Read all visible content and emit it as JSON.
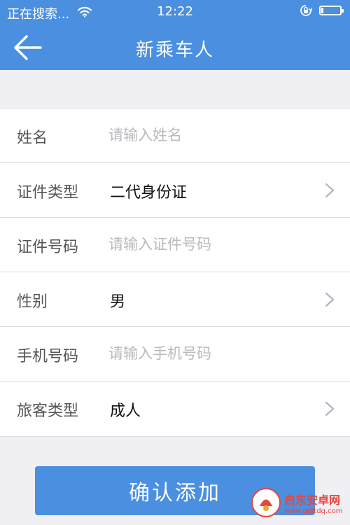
{
  "status_bar": {
    "carrier": "正在搜索...",
    "time": "12:22",
    "battery_level": 0.12
  },
  "nav": {
    "title": "新乘车人"
  },
  "form": {
    "name": {
      "label": "姓名",
      "placeholder": "请输入姓名"
    },
    "id_type": {
      "label": "证件类型",
      "value": "二代身份证"
    },
    "id_number": {
      "label": "证件号码",
      "placeholder": "请输入证件号码"
    },
    "gender": {
      "label": "性别",
      "value": "男"
    },
    "phone": {
      "label": "手机号码",
      "placeholder": "请输入手机号码"
    },
    "passenger_type": {
      "label": "旅客类型",
      "value": "成人"
    }
  },
  "confirm_button": {
    "label": "确认添加"
  },
  "watermark": {
    "name": "启东安卓网",
    "url": "www.qdltdq.com"
  },
  "colors": {
    "accent": "#4a8fe0",
    "background": "#efeff4",
    "placeholder": "#b9b9be",
    "watermark": "#e8463c"
  },
  "icons": {
    "back": "arrow-left-icon",
    "wifi": "wifi-icon",
    "lock": "rotation-lock-icon",
    "battery": "battery-icon",
    "chevron": "chevron-right-icon"
  }
}
